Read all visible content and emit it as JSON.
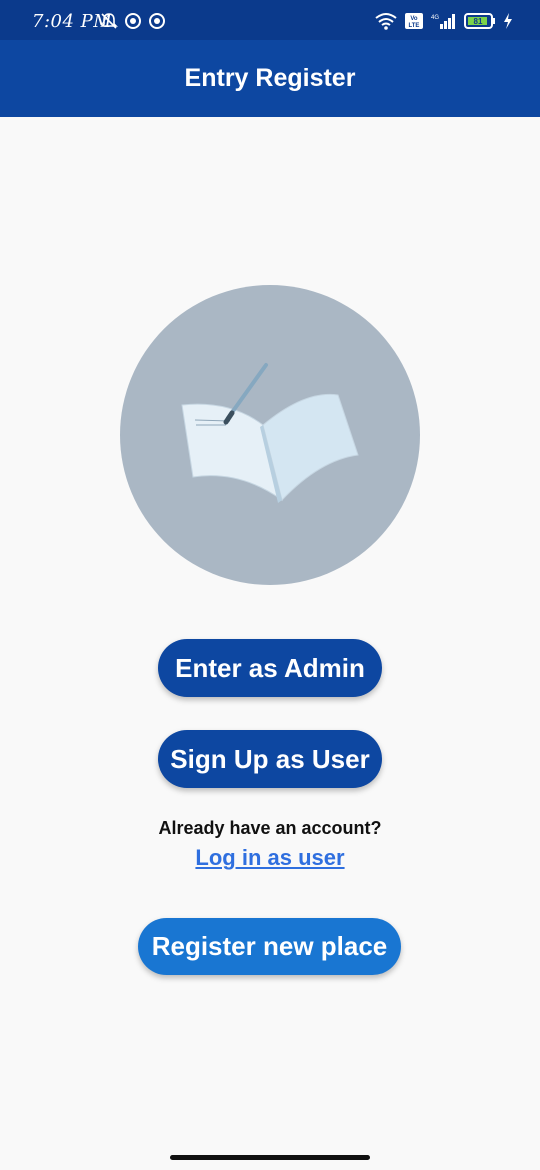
{
  "status_bar": {
    "time": "7:04 PM",
    "left_icons": [
      "alarm-off-icon",
      "circle-icon",
      "circle-icon"
    ],
    "right_icons": [
      "wifi-icon",
      "volte-icon",
      "4g-signal-icon",
      "battery-icon",
      "charging-icon"
    ],
    "volte_label": "Vo LTE",
    "network_label": "4G",
    "battery_label": "81"
  },
  "app_bar": {
    "title": "Entry Register"
  },
  "hero": {
    "icon": "open-book-with-pen"
  },
  "buttons": {
    "admin": "Enter as Admin",
    "signup": "Sign Up as User",
    "register": "Register new place"
  },
  "login": {
    "prompt": "Already have an account?",
    "link": "Log in as user"
  },
  "colors": {
    "status_bar": "#0b3a8c",
    "app_bar": "#0d47a1",
    "primary_button": "#0d47a1",
    "secondary_button": "#1976d2",
    "hero_circle": "#aab7c4",
    "link": "#2f6fdf",
    "background": "#f9f9f9"
  }
}
